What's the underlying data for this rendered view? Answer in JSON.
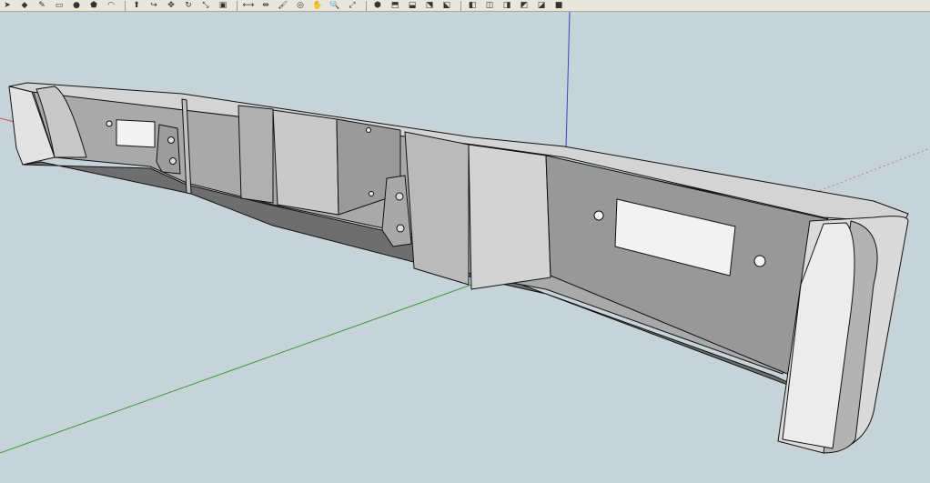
{
  "toolbar": {
    "groups": [
      [
        {
          "icon": "select-arrow-icon",
          "glyph": "➤"
        },
        {
          "icon": "eraser-icon",
          "glyph": "◆"
        },
        {
          "icon": "pencil-icon",
          "glyph": "✎"
        },
        {
          "icon": "rectangle-icon",
          "glyph": "▭"
        },
        {
          "icon": "circle-icon",
          "glyph": "●"
        },
        {
          "icon": "polygon-icon",
          "glyph": "⬟"
        },
        {
          "icon": "arc-icon",
          "glyph": "◠"
        }
      ],
      [
        {
          "icon": "push-pull-icon",
          "glyph": "⬆"
        },
        {
          "icon": "follow-me-icon",
          "glyph": "↪"
        },
        {
          "icon": "move-icon",
          "glyph": "✥"
        },
        {
          "icon": "rotate-icon",
          "glyph": "↻"
        },
        {
          "icon": "scale-icon",
          "glyph": "⤡"
        },
        {
          "icon": "offset-icon",
          "glyph": "▣"
        }
      ],
      [
        {
          "icon": "tape-measure-icon",
          "glyph": "⟷"
        },
        {
          "icon": "dimension-icon",
          "glyph": "⇹"
        },
        {
          "icon": "paint-bucket-icon",
          "glyph": "🖌"
        },
        {
          "icon": "orbit-icon",
          "glyph": "◎"
        },
        {
          "icon": "pan-icon",
          "glyph": "✋"
        },
        {
          "icon": "zoom-icon",
          "glyph": "🔍"
        },
        {
          "icon": "zoom-extents-icon",
          "glyph": "⤢"
        }
      ],
      [
        {
          "icon": "iso-view-icon",
          "glyph": "⬢"
        },
        {
          "icon": "top-view-icon",
          "glyph": "⬒"
        },
        {
          "icon": "front-view-icon",
          "glyph": "⬓"
        },
        {
          "icon": "right-view-icon",
          "glyph": "⬔"
        },
        {
          "icon": "back-view-icon",
          "glyph": "⬕"
        }
      ],
      [
        {
          "icon": "xray-icon",
          "glyph": "◧"
        },
        {
          "icon": "wireframe-icon",
          "glyph": "◫"
        },
        {
          "icon": "hidden-line-icon",
          "glyph": "◨"
        },
        {
          "icon": "shaded-icon",
          "glyph": "◩"
        },
        {
          "icon": "shaded-textures-icon",
          "glyph": "◪"
        },
        {
          "icon": "monochrome-icon",
          "glyph": "■"
        }
      ]
    ]
  },
  "viewport": {
    "background": "#c6d3d8",
    "axis_colors": {
      "red": "#c05050",
      "green": "#3f9a3f",
      "blue": "#4040c8"
    },
    "face_colors": {
      "light": "#e1e1e1",
      "mid": "#bdbdbd",
      "dark": "#8f8f8f",
      "darker": "#6e6e6e",
      "edge": "#111111"
    }
  }
}
